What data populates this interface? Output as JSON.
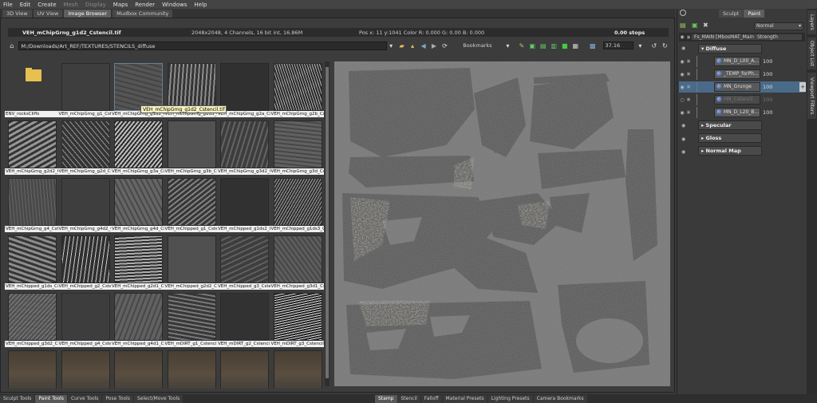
{
  "menu": [
    "File",
    "Edit",
    "Create",
    "Mesh",
    "Display",
    "Maps",
    "Render",
    "Windows",
    "Help"
  ],
  "menu_dim": [
    false,
    false,
    false,
    true,
    true,
    false,
    false,
    false,
    false
  ],
  "view_tabs": [
    "3D View",
    "UV View",
    "Image Browser",
    "Mudbox Community"
  ],
  "active_view_tab": 2,
  "info": {
    "filename": "VEH_mChipGrng_g1d2_Cstencil.tif",
    "details": "2048x2048, 4 Channels, 16 bit int, 16.86M",
    "pos": "Pos x: 11 y:1041 Color R: 0.000 G: 0.00 B: 0.000",
    "stops": "0.00 stops"
  },
  "path": "M:/Downloads/Art_REF/TEXTURES/STENCILS_diffuse",
  "bookmarks_label": "Bookmarks",
  "zoom_value": "37.16",
  "tooltip": "VEH_mChipGrng_g1d2_Cstencil.tif",
  "thumbnails": [
    [
      "ENV_rocksCliffs",
      "VEH_mChipGrng_g1_Cste",
      "VEH_mChipGrng_g1d2_C",
      "VEH_mChipGrng_g1d3_C",
      "VEH_mChipGrng_g2a_Cs",
      "VEH_mChipGrng_g2b_Cs"
    ],
    [
      "VEH_mChipGrng_g2d2_C",
      "VEH_mChipGrng_g2d_Cst",
      "VEH_mChipGrng_g3a_Cs",
      "VEH_mChipGrng_g3b_Cs",
      "VEH_mChipGrng_g3d2_C",
      "VEH_mChipGrng_g3d_Cst"
    ],
    [
      "VEH_mChipGrng_g4_Cste",
      "VEH_mChipGrng_g4d2_C",
      "VEH_mChipGrng_g4d_Cs",
      "VEH_mChipped_g1_Cste",
      "VEH_mChipped_g1ds2_C",
      "VEH_mChipped_g1ds3_C"
    ],
    [
      "VEH_mChipped_g1ds_Cst",
      "VEH_mChipped_g2_Cste",
      "VEH_mChipped_g2d1_Cs",
      "VEH_mChipped_g2d2_Cs",
      "VEH_mChipped_g3_Cste",
      "VEH_mChipped_g3d1_Cs"
    ],
    [
      "VEH_mChipped_g3d2_Cs",
      "VEH_mChipped_g4_Cste",
      "VEH_mChipped_g4d1_Cs",
      "VEH_mDIRT_g1_Cstenci",
      "VEH_mDIRT_g2_Cstenci",
      "VEH_mDIRT_g3_Cstencil"
    ],
    [
      "",
      "",
      "",
      "",
      "",
      ""
    ]
  ],
  "bottom_tabs_left": [
    "Sculpt Tools",
    "Paint Tools",
    "Curve Tools",
    "Pose Tools",
    "Select/Move Tools"
  ],
  "active_bottom_left": 1,
  "bottom_tabs_right": [
    "Stamp",
    "Stencil",
    "Falloff",
    "Material Presets",
    "Lighting Presets",
    "Camera Bookmarks"
  ],
  "active_bottom_right": 0,
  "right": {
    "mode_tabs": [
      "Sculpt",
      "Paint"
    ],
    "active_mode": 1,
    "blend_mode": "Normal",
    "header_name": "Fs_MAIN [MbosMAT_Main",
    "header_strength": "Strength",
    "groups": {
      "diffuse": "Diffuse",
      "specular": "Specular",
      "gloss": "Gloss",
      "normal": "Normal Map"
    },
    "layers": [
      {
        "name": "MN_D_L00_A...",
        "value": "100"
      },
      {
        "name": "_TEMP_forPh...",
        "value": "100"
      },
      {
        "name": "MN_Grunge",
        "value": "100"
      },
      {
        "name": "MN_Cstencil",
        "value": "100"
      },
      {
        "name": "MN_D_L20_B...",
        "value": "100"
      }
    ],
    "side_tabs": [
      "Layers",
      "Object List",
      "Viewport Filters"
    ]
  },
  "colors": {
    "accent": "#8fb6d0",
    "selection": "#4a6a8a"
  }
}
